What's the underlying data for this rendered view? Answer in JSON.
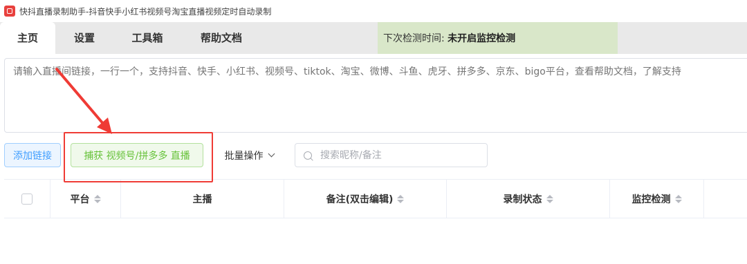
{
  "window": {
    "title": "快抖直播录制助手-抖音快手小红书视频号淘宝直播视频定时自动录制",
    "icon": "app-logo-icon"
  },
  "tabs": [
    {
      "label": "主页",
      "active": true
    },
    {
      "label": "设置",
      "active": false
    },
    {
      "label": "工具箱",
      "active": false
    },
    {
      "label": "帮助文档",
      "active": false
    }
  ],
  "status": {
    "label": "下次检测时间:",
    "value": "未开启监控检测",
    "background": "#d9e7c9"
  },
  "url_input": {
    "placeholder": "请输入直播间链接，一行一个，支持抖音、快手、小红书、视频号、tiktok、淘宝、微博、斗鱼、虎牙、拼多多、京东、bigo平台，查看帮助文档，了解支持"
  },
  "actions": {
    "add_link": "添加链接",
    "capture": "捕获 视频号/拼多多 直播",
    "batch": "批量操作",
    "search_placeholder": "搜索昵称/备注"
  },
  "table": {
    "columns": [
      {
        "label": "",
        "type": "checkbox"
      },
      {
        "label": "平台",
        "sortable": true
      },
      {
        "label": "主播",
        "sortable": false
      },
      {
        "label": "备注(双击编辑)",
        "sortable": true
      },
      {
        "label": "录制状态",
        "sortable": true
      },
      {
        "label": "监控检测",
        "sortable": true
      }
    ],
    "rows": []
  },
  "colors": {
    "primary": "#409eff",
    "success": "#67c23a",
    "annotation": "#ef3b35"
  }
}
